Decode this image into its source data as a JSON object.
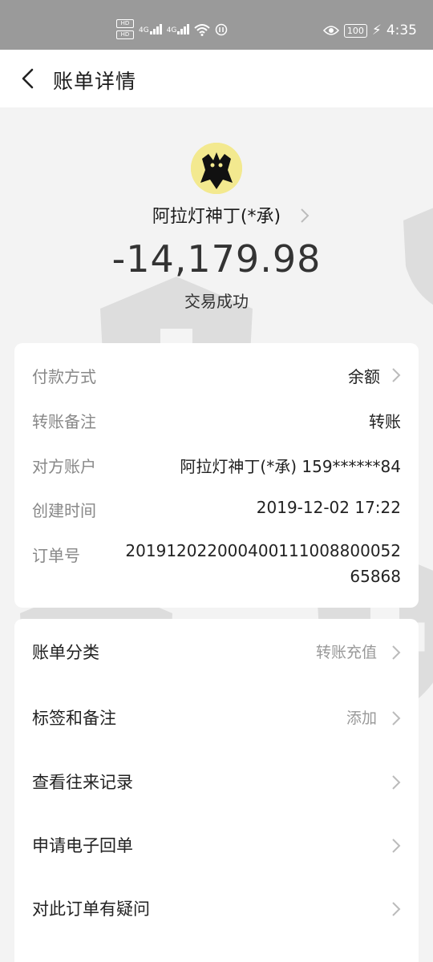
{
  "status_bar": {
    "sim1": "HD",
    "sim2": "HD",
    "net1": "4G",
    "net2": "4G",
    "battery": "100",
    "time": "4:35"
  },
  "nav": {
    "title": "账单详情"
  },
  "payee": {
    "name": "阿拉灯神丁(*承)"
  },
  "amount": "-14,179.98",
  "status": "交易成功",
  "details": [
    {
      "label": "付款方式",
      "value": "余额"
    },
    {
      "label": "转账备注",
      "value": "转账"
    },
    {
      "label": "对方账户",
      "value": "阿拉灯神丁(*承) 159******84"
    },
    {
      "label": "创建时间",
      "value": "2019-12-02 17:22"
    },
    {
      "label": "订单号",
      "value": "201912022000400111008800052 65868"
    }
  ],
  "menu": [
    {
      "label": "账单分类",
      "value": "转账充值"
    },
    {
      "label": "标签和备注",
      "value": "添加"
    },
    {
      "label": "查看往来记录",
      "value": ""
    },
    {
      "label": "申请电子回单",
      "value": ""
    },
    {
      "label": "对此订单有疑问",
      "value": ""
    }
  ]
}
